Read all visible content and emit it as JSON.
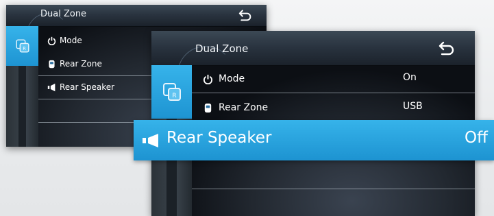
{
  "header": {
    "title": "Dual  Zone"
  },
  "menu": {
    "mode": {
      "label": "Mode",
      "value": "On"
    },
    "rear_zone": {
      "label": "Rear Zone",
      "value": "USB"
    },
    "rear_speaker": {
      "label": "Rear Speaker",
      "value": "Off"
    }
  },
  "icons": {
    "back": "back-arrow-icon",
    "dual_zone": "dual-zone-icon",
    "power": "power-icon",
    "rear_zone": "rear-zone-icon",
    "speaker": "speaker-icon"
  },
  "colors": {
    "accent": "#1e94d2",
    "background": "#0b0e13",
    "text": "#ffffff"
  }
}
